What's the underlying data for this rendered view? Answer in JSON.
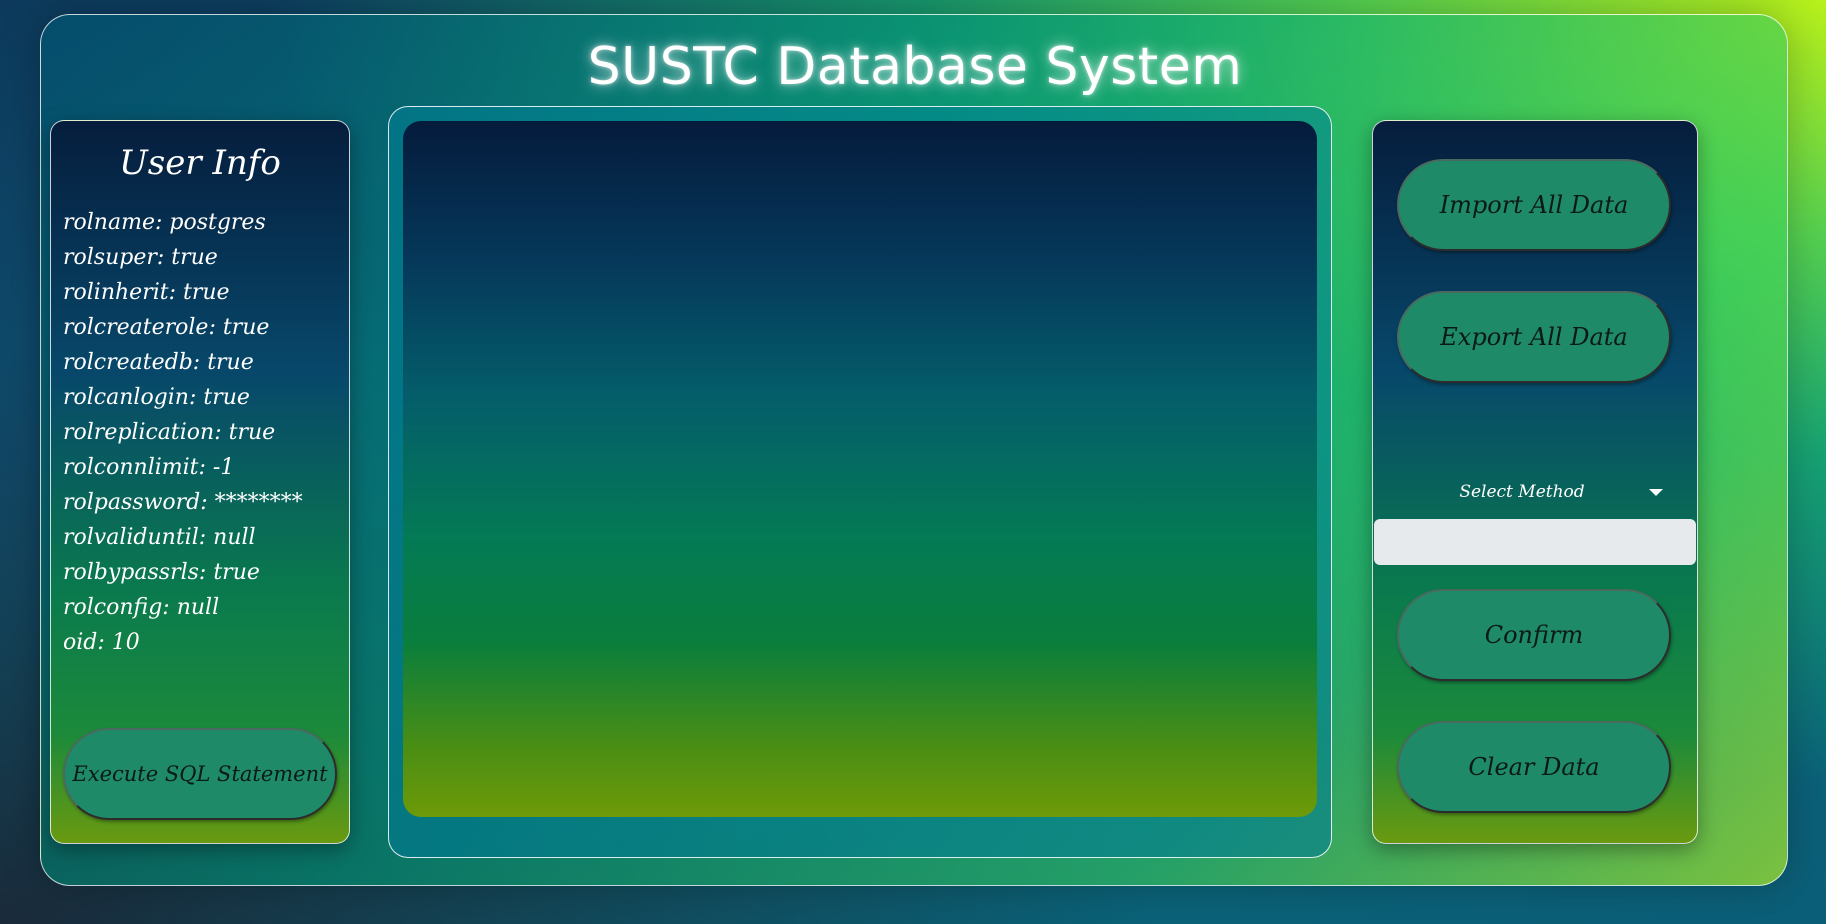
{
  "app": {
    "title": "SUSTC Database System"
  },
  "user_info": {
    "title": "User Info",
    "fields": [
      "rolname: postgres",
      "rolsuper: true",
      "rolinherit: true",
      "rolcreaterole: true",
      "rolcreatedb: true",
      "rolcanlogin: true",
      "rolreplication: true",
      "rolconnlimit: -1",
      "rolpassword: ********",
      "rolvaliduntil: null",
      "rolbypassrls: true",
      "rolconfig: null",
      "oid: 10"
    ],
    "execute_label": "Execute SQL Statement"
  },
  "actions": {
    "import_label": "Import All Data",
    "export_label": "Export All Data",
    "select_method": {
      "selected": "Select Method",
      "icon": "chevron-down-icon"
    },
    "method_input": {
      "value": "",
      "placeholder": ""
    },
    "confirm_label": "Confirm",
    "clear_label": "Clear Data"
  },
  "colors": {
    "button_fill": "#1f8a68",
    "panel_top": "#061d3d",
    "panel_bottom": "#6a9a10",
    "accent_glow": "#b8f01a"
  }
}
